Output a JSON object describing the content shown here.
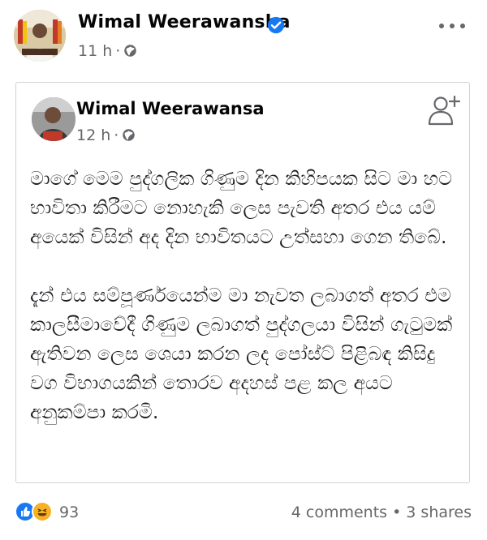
{
  "post": {
    "author": "Wimal Weerawansha",
    "time": "11 h",
    "separator": "·",
    "privacy_icon": "globe-icon",
    "verified_icon": "verified-badge-icon",
    "more_icon": "more-options-icon"
  },
  "shared_post": {
    "author": "Wimal Weerawansa",
    "time": "12 h",
    "separator": "·",
    "privacy_icon": "globe-icon",
    "action_icon": "add-friend-icon",
    "paragraphs": [
      "මාගේ මෙම පුද්ගලික ගිණුම දින කිහිපයක සිට මා හට භාවිතා කිරීමට නොහැකි ලෙස පැවති අතර එය යම් අයෙක් විසින් අද දින භාවිතයට උත්සහා ගෙන තිබේ.",
      "දැන් එය සම්පූර්ණයෙන්ම මා නැවත ලබාගත් අතර එම කාලසීමාවේදී ගිණුම ලබාගත් පුද්ගලයා විසින් ගැටුමක් ඇතිවන ලෙස ශෙයා කරන ලද පෝස්ට් පිළිබඳ කිසිදු වග විභාගයකින් තොරව අදහස් පළ කල අයට අනුකම්පා කරමි."
    ]
  },
  "footer": {
    "reaction_count": "93",
    "comments": "4 comments",
    "separator": "•",
    "shares": "3 shares",
    "reaction_icons": [
      "like-icon",
      "haha-icon"
    ]
  },
  "colors": {
    "verified": "#1877f2",
    "secondary_text": "#65676b",
    "like": "#1877f2",
    "haha": "#f7b125"
  }
}
